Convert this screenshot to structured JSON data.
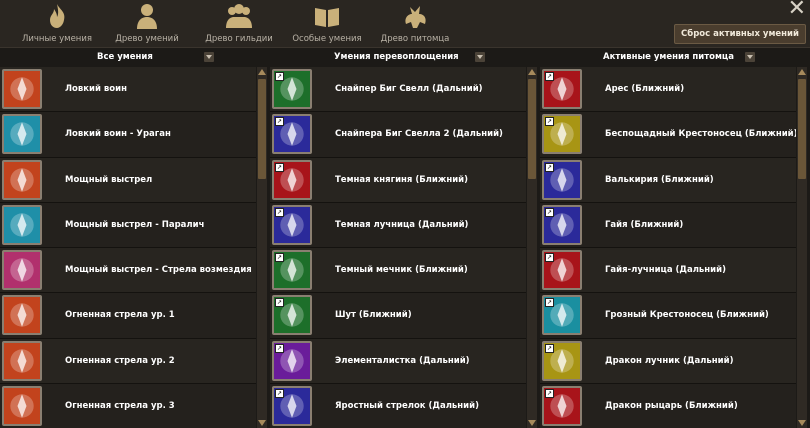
{
  "tabs": [
    {
      "label": "Личные умения",
      "icon": "flame-icon"
    },
    {
      "label": "Древо умений",
      "icon": "person-icon"
    },
    {
      "label": "Древо гильдии",
      "icon": "group-icon"
    },
    {
      "label": "Особые умения",
      "icon": "book-icon"
    },
    {
      "label": "Древо питомца",
      "icon": "pet-icon"
    }
  ],
  "reset_label": "Сброс активных умений",
  "columns": {
    "all": "Все умения",
    "transform": "Умения перевоплощения",
    "pet": "Активные умения питомца"
  },
  "all_skills": [
    {
      "label": "Ловкий воин",
      "color": "#c2431d"
    },
    {
      "label": "Ловкий воин - Ураган",
      "color": "#1f8fa8"
    },
    {
      "label": "Мощный выстрел",
      "color": "#c2431d"
    },
    {
      "label": "Мощный выстрел - Паралич",
      "color": "#1f8fa8"
    },
    {
      "label": "Мощный выстрел - Стрела возмездия",
      "color": "#b1306d"
    },
    {
      "label": "Огненная стрела ур. 1",
      "color": "#c2431d"
    },
    {
      "label": "Огненная стрела ур. 2",
      "color": "#c2431d"
    },
    {
      "label": "Огненная стрела ур. 3",
      "color": "#c2431d"
    }
  ],
  "transform_skills": [
    {
      "label": "Снайпер Биг Свелл (Дальний)",
      "color": "#1d6f2a"
    },
    {
      "label": "Снайпера Биг Свелла 2 (Дальний)",
      "color": "#2b2a9a"
    },
    {
      "label": "Темная княгиня (Ближний)",
      "color": "#a8141a"
    },
    {
      "label": "Темная лучница (Дальний)",
      "color": "#2b2a9a"
    },
    {
      "label": "Темный мечник (Ближний)",
      "color": "#1d6f2a"
    },
    {
      "label": "Шут (Ближний)",
      "color": "#1d6f2a"
    },
    {
      "label": "Элементалистка (Дальний)",
      "color": "#6a1c9a"
    },
    {
      "label": "Яростный стрелок (Дальний)",
      "color": "#2b2a9a"
    }
  ],
  "pet_skills": [
    {
      "label": "Арес (Ближний)",
      "color": "#a8141a"
    },
    {
      "label": "Беспощадный Крестоносец (Ближний)",
      "color": "#a89514"
    },
    {
      "label": "Валькирия (Ближний)",
      "color": "#2b2a9a"
    },
    {
      "label": "Гайя (Ближний)",
      "color": "#2b2a9a"
    },
    {
      "label": "Гайя-лучница (Дальний)",
      "color": "#a8141a"
    },
    {
      "label": "Грозный Крестоносец (Ближний)",
      "color": "#1a8fa0"
    },
    {
      "label": "Дракон лучник (Дальний)",
      "color": "#a89514"
    },
    {
      "label": "Дракон рыцарь (Ближний)",
      "color": "#a8141a"
    }
  ]
}
